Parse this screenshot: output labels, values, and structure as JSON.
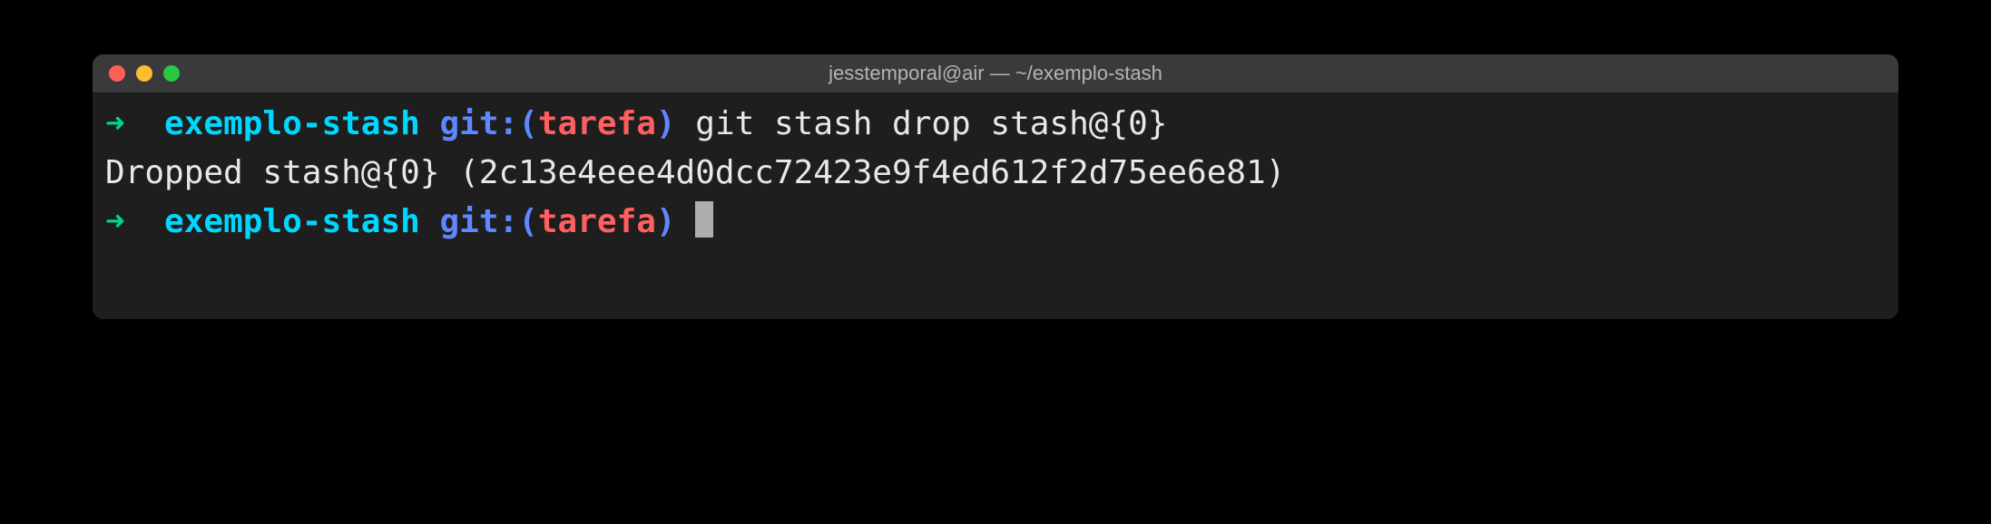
{
  "window": {
    "title": "jesstemporal@air — ~/exemplo-stash"
  },
  "colors": {
    "arrow": "#00d787",
    "dir": "#00d7ff",
    "git": "#5f87ff",
    "branch": "#ff5f5f",
    "text": "#e8e8e8",
    "bg": "#1e1e1e",
    "titlebar": "#3a3a3c"
  },
  "prompt": {
    "arrow": "➜",
    "directory": "exemplo-stash",
    "git_label": "git:(",
    "branch": "tarefa",
    "git_close": ")"
  },
  "lines": {
    "line1_command": "git stash drop stash@{0}",
    "line2_output": "Dropped stash@{0} (2c13e4eee4d0dcc72423e9f4ed612f2d75ee6e81)"
  }
}
